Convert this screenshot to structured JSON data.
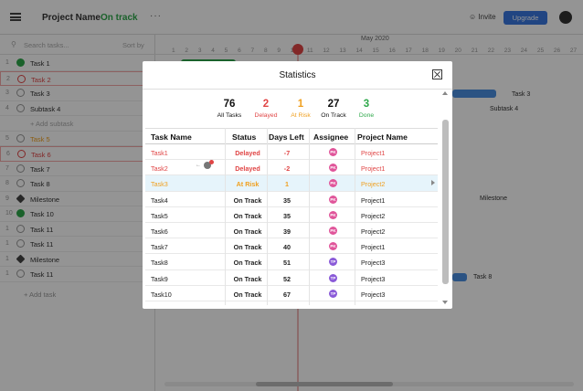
{
  "app": {
    "project_name": "Project Name",
    "project_status": "On track",
    "more": "···",
    "invite_label": "Invite",
    "upgrade_label": "Upgrade",
    "search_placeholder": "Search tasks...",
    "sort_by": "Sort by",
    "add_task": "+ Add task",
    "month": "May 2020"
  },
  "background_tasks": [
    {
      "num": "1",
      "label": "Task 1",
      "state": "done"
    },
    {
      "num": "2",
      "label": "Task 2",
      "state": "red"
    },
    {
      "num": "3",
      "label": "Task 3",
      "state": "open"
    },
    {
      "num": "4",
      "label": "Subtask 4",
      "state": "open"
    },
    {
      "num": "",
      "label": "+ Add subtask",
      "state": "add"
    },
    {
      "num": "5",
      "label": "Task 5",
      "state": "orange"
    },
    {
      "num": "6",
      "label": "Task 6",
      "state": "red"
    },
    {
      "num": "7",
      "label": "Task 7",
      "state": "open"
    },
    {
      "num": "8",
      "label": "Task 8",
      "state": "open"
    },
    {
      "num": "9",
      "label": "Milestone",
      "state": "milestone"
    },
    {
      "num": "10",
      "label": "Task 10",
      "state": "done"
    },
    {
      "num": "1",
      "label": "Task 11",
      "state": "open"
    },
    {
      "num": "1",
      "label": "Task 11",
      "state": "open"
    },
    {
      "num": "1",
      "label": "Milestone",
      "state": "milestone"
    },
    {
      "num": "1",
      "label": "Task 11",
      "state": "open"
    }
  ],
  "timeline_days": "1 2 3 4 5 6 7 8 9 10 11 12 13 14 15 16 17 18 19 20 21 22 23 24 25 26 27",
  "timeline_today": "10",
  "timeline_labels": {
    "task3": "Task 3",
    "subtask4": "Subtask 4",
    "milestone": "Milestone",
    "task8": "Task 8"
  },
  "modal": {
    "title": "Statistics",
    "stats": [
      {
        "value": "76",
        "caption": "All Tasks",
        "color": "#111111"
      },
      {
        "value": "2",
        "caption": "Delayed",
        "color": "#e04545"
      },
      {
        "value": "1",
        "caption": "At Risk",
        "color": "#f0a020"
      },
      {
        "value": "27",
        "caption": "On Track",
        "color": "#111111"
      },
      {
        "value": "3",
        "caption": "Done",
        "color": "#2ea84a"
      }
    ],
    "columns": [
      "Task Name",
      "Status",
      "Days Left",
      "Assignee",
      "Project Name"
    ],
    "rows": [
      {
        "task": "Task1",
        "status": "Delayed",
        "days": "-7",
        "assignee": "PK",
        "project": "Project1",
        "tone": "red"
      },
      {
        "task": "Task2",
        "status": "Delayed",
        "days": "-2",
        "assignee": "PK",
        "project": "Project1",
        "tone": "red"
      },
      {
        "task": "Task3",
        "status": "At Risk",
        "days": "1",
        "assignee": "PK",
        "project": "Project2",
        "tone": "orange"
      },
      {
        "task": "Task4",
        "status": "On Track",
        "days": "35",
        "assignee": "PK",
        "project": "Project1",
        "tone": "normal"
      },
      {
        "task": "Task5",
        "status": "On Track",
        "days": "35",
        "assignee": "PK",
        "project": "Project2",
        "tone": "normal"
      },
      {
        "task": "Task6",
        "status": "On Track",
        "days": "39",
        "assignee": "PK",
        "project": "Project2",
        "tone": "normal"
      },
      {
        "task": "Task7",
        "status": "On Track",
        "days": "40",
        "assignee": "PK",
        "project": "Project1",
        "tone": "normal"
      },
      {
        "task": "Task8",
        "status": "On Track",
        "days": "51",
        "assignee": "TP",
        "project": "Project3",
        "tone": "normal"
      },
      {
        "task": "Task9",
        "status": "On Track",
        "days": "52",
        "assignee": "TP",
        "project": "Project3",
        "tone": "normal"
      },
      {
        "task": "Task10",
        "status": "On Track",
        "days": "67",
        "assignee": "TP",
        "project": "Project3",
        "tone": "normal"
      }
    ],
    "row2_mini": "←",
    "colors": {
      "red": "#e04545",
      "orange": "#f0a020",
      "normal": "#222222",
      "pk": "#e0559a",
      "tp": "#8a5ad8",
      "selected_row": "#e6f4fb"
    }
  }
}
